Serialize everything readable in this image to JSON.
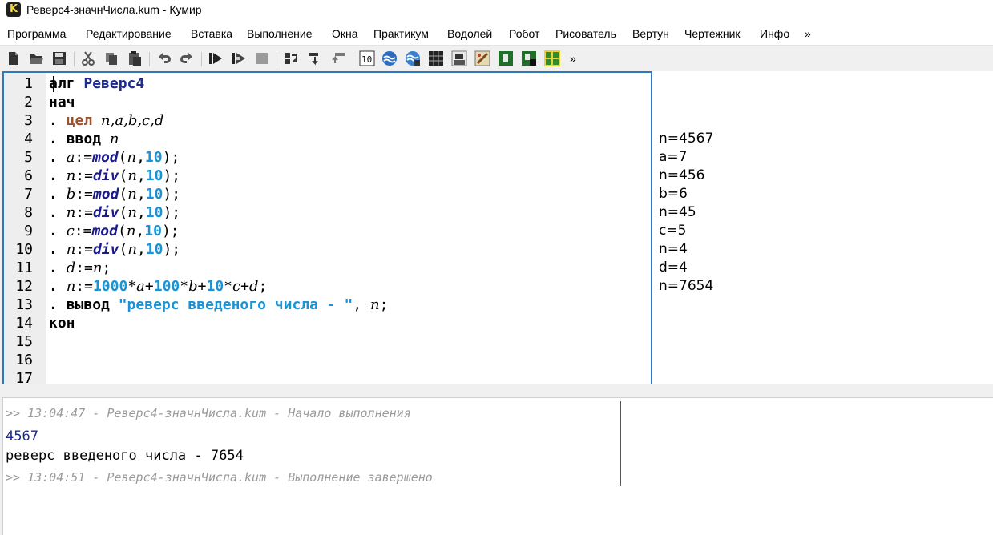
{
  "window": {
    "title": "Реверс4-значнЧисла.kum - Кумир",
    "app_icon_letter": "K"
  },
  "menu": [
    "Программа",
    "Редактирование",
    "Вставка",
    "Выполнение",
    "Окна",
    "Практикум",
    "Водолей",
    "Робот",
    "Рисователь",
    "Вертун",
    "Чертежник",
    "Инфо",
    "»"
  ],
  "toolbar": {
    "icons": [
      "new-file-icon",
      "open-folder-icon",
      "save-icon",
      "cut-icon",
      "copy-icon",
      "paste-icon",
      "undo-icon",
      "redo-icon",
      "run-icon",
      "step-run-icon",
      "stop-icon",
      "step-over-icon",
      "step-in-icon",
      "step-out-icon",
      "counter-actor-icon",
      "aquarius-actor-icon",
      "aquarius-alt-actor-icon",
      "grid-actor-icon",
      "robot-actor-icon",
      "painter-actor-icon",
      "turtle-actor-icon",
      "calculator-actor-icon",
      "draw-actor-icon"
    ],
    "more": "»"
  },
  "editor": {
    "line_numbers": [
      "1",
      "2",
      "3",
      "4",
      "5",
      "6",
      "7",
      "8",
      "9",
      "10",
      "11",
      "12",
      "13",
      "14",
      "15",
      "16",
      "17"
    ],
    "l1": {
      "kw": "алг",
      "name": "Реверс4"
    },
    "l2": {
      "kw": "нач"
    },
    "l3": {
      "kw": "цел",
      "vars": "n,a,b,c,d"
    },
    "l4": {
      "kw": "ввод",
      "var": "n"
    },
    "l5": {
      "var": "a",
      "fn": "mod",
      "arg": "n",
      "num": "10"
    },
    "l6": {
      "var": "n",
      "fn": "div",
      "arg": "n",
      "num": "10"
    },
    "l7": {
      "var": "b",
      "fn": "mod",
      "arg": "n",
      "num": "10"
    },
    "l8": {
      "var": "n",
      "fn": "div",
      "arg": "n",
      "num": "10"
    },
    "l9": {
      "var": "c",
      "fn": "mod",
      "arg": "n",
      "num": "10"
    },
    "l10": {
      "var": "n",
      "fn": "div",
      "arg": "n",
      "num": "10"
    },
    "l11": {
      "var": "d",
      "arg": "n"
    },
    "l12": {
      "var": "n",
      "n1": "1000",
      "v1": "a",
      "n2": "100",
      "v2": "b",
      "n3": "10",
      "v3": "c",
      "v4": "d"
    },
    "l13": {
      "kw": "вывод",
      "str": "\"реверс введеного числа - \"",
      "var": "n"
    },
    "l14": {
      "kw": "кон"
    },
    "dot": ".",
    "assign": ":=",
    "semicolon": ";"
  },
  "margin_values": [
    "n=4567",
    "a=7",
    "n=456",
    "b=6",
    "n=45",
    "c=5",
    "n=4",
    "d=4",
    "n=7654"
  ],
  "console": {
    "start_log": ">> 13:04:47 - Реверс4-значнЧисла.kum - Начало выполнения",
    "input_echo": "4567",
    "output": "реверс введеного числа - 7654",
    "end_log": ">> 13:04:51 - Реверс4-значнЧисла.kum - Выполнение завершено"
  }
}
